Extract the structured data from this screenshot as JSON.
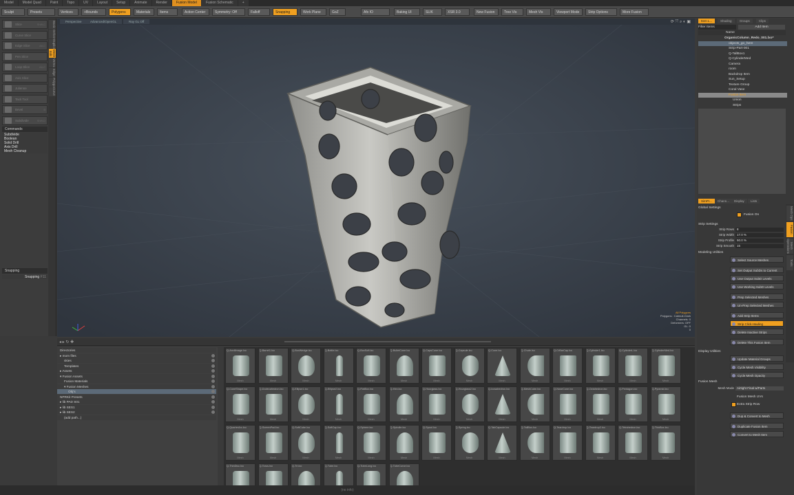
{
  "top_tabs": [
    "Model",
    "Model Quad",
    "Paint",
    "Topo",
    "UV",
    "Layout",
    "Setup",
    "Animate",
    "Render",
    "Fusion Model",
    "Fusion Schematic",
    "+"
  ],
  "active_tab_index": 9,
  "toolbar": [
    {
      "label": "Sculpt"
    },
    {
      "label": "Presets"
    },
    {
      "label": "Vertices"
    },
    {
      "label": "+Bounds"
    },
    {
      "label": "Polygons",
      "on": true
    },
    {
      "label": "Materials"
    },
    {
      "label": "Items"
    },
    {
      "label": "Action Center"
    },
    {
      "label": "Symmetry: Off"
    },
    {
      "label": "Falloff"
    },
    {
      "label": "Snapping",
      "on": true
    },
    {
      "label": "Work Plane"
    },
    {
      "label": "GoZ"
    },
    {
      "label": "Afx IO"
    },
    {
      "label": "Baking UI"
    },
    {
      "label": "SLIK"
    },
    {
      "label": "XSR 3.0"
    },
    {
      "label": "New Fusion"
    },
    {
      "label": "Tree Vis"
    },
    {
      "label": "Mesh Vis"
    },
    {
      "label": "Viewport Mode"
    },
    {
      "label": "Strip Options"
    },
    {
      "label": "More Fusion"
    }
  ],
  "left_vtabs": [
    "Basic",
    "Deform",
    "Duplicate",
    "Mesh Edit",
    "Vertex",
    "Edge",
    "Polygon",
    "Curve"
  ],
  "left_vtab_active": 3,
  "tools": [
    {
      "label": "Slice",
      "key": "Shift-C"
    },
    {
      "label": "Curve Slice",
      "key": ""
    },
    {
      "label": "Edge Slice",
      "key": "Alt-C"
    },
    {
      "label": "Pen Slice",
      "key": ""
    },
    {
      "label": "Loop Slice",
      "key": "Alt-C"
    },
    {
      "label": "Axis Slice",
      "key": ""
    },
    {
      "label": "Julienne",
      "key": ""
    },
    {
      "label": "Tack Tool",
      "key": ""
    },
    {
      "label": "Bevel",
      "key": "B"
    },
    {
      "label": "Subdivide",
      "key": "Shift-D"
    }
  ],
  "commands_title": "Commands",
  "commands": [
    "Subdivide",
    "Boolean",
    "Solid Drill",
    "Axis Drill",
    "Mesh Cleanup"
  ],
  "snapping": {
    "title": "Snapping",
    "label": "Snapping",
    "value": "F11"
  },
  "viewport": {
    "tabs": [
      "Perspective",
      "Advanced/OpenGL",
      "Ray GL Off"
    ],
    "info": [
      "All Polygons",
      "Polygons : Catmull-Clark",
      "Channels: 0",
      "Deformers: OFF",
      "GL: 0",
      "0"
    ]
  },
  "directories": [
    {
      "label": "Directories",
      "indent": 0
    },
    {
      "label": "▸ mom files",
      "indent": 0
    },
    {
      "label": "skies",
      "indent": 1
    },
    {
      "label": "Templates",
      "indent": 1
    },
    {
      "label": "▸ Assets",
      "indent": 0
    },
    {
      "label": "▾ Fusion Assets",
      "indent": 0
    },
    {
      "label": "Fusion Materials",
      "indent": 1
    },
    {
      "label": "▾ Fusion Meshes",
      "indent": 1
    },
    {
      "label": "Obj's",
      "indent": 2,
      "sel": true
    },
    {
      "label": "NPRKit Presets",
      "indent": 0
    },
    {
      "label": "▸ lib PAD S01",
      "indent": 0
    },
    {
      "label": "▸ lib SES1",
      "indent": 0
    },
    {
      "label": "▸ lib SES2",
      "indent": 0
    },
    {
      "label": "(add path...)",
      "indent": 1
    }
  ],
  "thumbs": [
    "Q-AnvilImage.lxo",
    "Q-Barrel1.lxo",
    "Q-BoxWedge.lxo",
    "Q-Bottle.lxo",
    "Q-BoxSoft.lxo",
    "Q-BulletCone.lxo",
    "Q-CapsCone.lxo",
    "Q-Capsule.lxo",
    "Q-Cone.lxo",
    "Q-Chute.lxo",
    "Q-CrBarCap.lxo",
    "Q-Cylinder1.lxo",
    "Q-CylinderL.lxo",
    "Q-CylinderMed.lxo",
    "Q-ConeShape.lxo",
    "Q-Dodecahedron.lxo",
    "Q-Ellipse1.lxo",
    "Q-Ellipse2.lxo",
    "Q-FlatBox.lxo",
    "Q-Hex.lxo",
    "Q-Hourglass.lxo",
    "Q-Hourglass2.lxo",
    "Q-Icosahedron.lxo",
    "Q-MeshCube.lxo",
    "Q-NoseCone.lxo",
    "Q-Octahedron.lxo",
    "Q-Pentagon.lxo",
    "Q-Pyramid.lxo",
    "Q-QuarterArc.lxo",
    "Q-ScreenPad.lxo",
    "Q-SoftCube.lxo",
    "Q-SoftCap.lxo",
    "Q-Sphere.lxo",
    "Q-Spindle.lxo",
    "Q-Spool.lxo",
    "Q-Spring.lxo",
    "Q-TabCapsule.lxo",
    "Q-TallBox.lxo",
    "Q-Teardrop.lxo",
    "Q-Teardrop2.lxo",
    "Q-Tetrahedron.lxo",
    "Q-ThinBox.lxo",
    "Q-ThinDisc.lxo",
    "Q-Torus.lxo",
    "Q-Tri.lxo",
    "Q-Tube.lxo",
    "Q-TubeLong.lxo",
    "Q-TubeCurve.lxo"
  ],
  "thumb_caption": "Mesh",
  "status_text": "(no info)",
  "right": {
    "tabs": [
      "Item L...",
      "Shading",
      "Groups",
      "Clips"
    ],
    "filter": "Filter Items",
    "add_item": "Add Item",
    "name_col": "Name",
    "items": [
      {
        "label": "OrganicColumn_Redo_001.lxo*",
        "indent": 0,
        "bold": true
      },
      {
        "label": "objects_go_here",
        "indent": 1,
        "sel": true
      },
      {
        "label": "Strip-Part-001",
        "indent": 1
      },
      {
        "label": "Q-TallBox1",
        "indent": 1
      },
      {
        "label": "Q-CylinderMed",
        "indent": 1
      },
      {
        "label": "Camera",
        "indent": 1
      },
      {
        "label": "room",
        "indent": 1
      },
      {
        "label": "Backdrop Item",
        "indent": 1
      },
      {
        "label": "Sun_Setup",
        "indent": 1
      },
      {
        "label": "Texture Group",
        "indent": 1
      },
      {
        "label": "Coral Vase",
        "indent": 1
      },
      {
        "label": "Fusion Item",
        "indent": 1,
        "hl": true
      },
      {
        "label": "Union",
        "indent": 2
      },
      {
        "label": "Strips",
        "indent": 2
      }
    ],
    "prop_tabs": [
      "SimPr...",
      "Chann...",
      "Display",
      "Lists"
    ],
    "global_settings": "Global Settings",
    "fusion_on": "Fusion On",
    "strip_settings": "Strip Settings",
    "strip_fields": [
      {
        "label": "Strip Rows",
        "value": "8"
      },
      {
        "label": "Strip Width",
        "value": "17.0 %"
      },
      {
        "label": "Strip Profile",
        "value": "50.0 %"
      },
      {
        "label": "Strip Smooth",
        "value": "15"
      }
    ],
    "modeling_utilities": "Modeling Utilities",
    "util_buttons": [
      {
        "label": "Select Source Meshes"
      },
      {
        "label": "Set Output SubDs to Current"
      },
      {
        "label": "Use Output SubD Levels"
      },
      {
        "label": "Use Working SubD Levels"
      },
      {
        "label": "Prep Selected Meshes"
      },
      {
        "label": "Un-Prep Selected Meshes"
      },
      {
        "label": "Add Strip Items"
      },
      {
        "label": "Strip Click-Hauling",
        "on": true
      },
      {
        "label": "Delete Inactive Strips"
      },
      {
        "label": "Delete This Fusion Item"
      }
    ],
    "display_utilities": "Display Utilities",
    "display_buttons": [
      "Update Material Groups",
      "Cycle Mesh Visibility",
      "Cycle Mesh Opacity"
    ],
    "fusion_mesh": "Fusion Mesh",
    "mesh_mode_label": "Mesh Mode",
    "mesh_mode_value": "Airtight Final w/Parts",
    "fusion_mesh_uvs": "Fusion Mesh UVs",
    "extra_strip_row": "Extra Strip Row",
    "fm_buttons": [
      "Dup & Convert to Mesh",
      "Duplicate Fusion Item",
      "Convert to Mesh Item"
    ],
    "rvtabs": [
      "Mesh Ops",
      "Fusion",
      "Mesh Operations",
      "Tools"
    ]
  },
  "colors": {
    "accent": "#f0a020",
    "viewport": "#363d47",
    "selection": "#5c6a78"
  }
}
